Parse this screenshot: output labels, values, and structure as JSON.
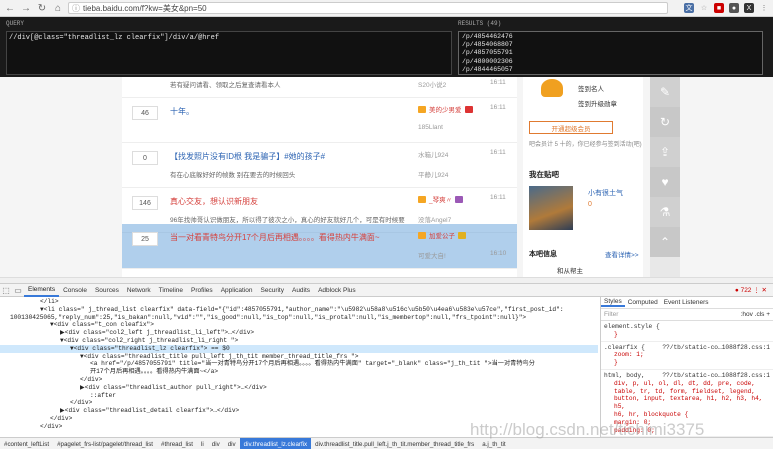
{
  "browser": {
    "url": "tieba.baidu.com/f?kw=美女&pn=50",
    "back_icon": "arrow-left-icon",
    "forward_icon": "arrow-right-icon",
    "reload_icon": "reload-icon",
    "home_icon": "home-icon"
  },
  "xpath_helper": {
    "query_label": "QUERY",
    "query": "//div[@class=\"threadlist_lz clearfix\"]/div/a/@href",
    "results_label": "RESULTS (49)",
    "results": [
      "/p/4854462476",
      "/p/4854068807",
      "/p/4857055791",
      "/p/4800002306",
      "/p/4844465057"
    ]
  },
  "threads": [
    {
      "count": "",
      "title": "",
      "abstract": "若有疑问请看、领取之后复查请看本人",
      "author": "",
      "last": "S20小说2",
      "time": "16:11"
    },
    {
      "count": "46",
      "title": "十年。",
      "abstract": "",
      "author": "美的少男爱",
      "last": "185Llant",
      "time": "16:11"
    },
    {
      "count": "0",
      "title": "【找发照片没有ID根 我是骗子】#她的孩子#",
      "abstract": "有在心底躲好好的帧数 别在要去的时候回头",
      "author": "水箱儿924",
      "last": "平静儿924",
      "time": "16:11"
    },
    {
      "count": "146",
      "title": "真心交友，想认识新朋友",
      "abstract": "96年找帅哥认识做朋友，所以得了彼次之小，真心的好友就好几个，可是有时候要",
      "author": "_琴爽〃",
      "last": "没落Angel7",
      "time": "16:11"
    },
    {
      "count": "25",
      "title": "当一对看青特鸟分开17个月后再相遇。。。。看得热内牛满面~",
      "abstract": "",
      "author": "加爱公子",
      "last": "可爱大自!",
      "time": "16:10"
    }
  ],
  "sidebar": {
    "sign_label": "签到名人",
    "more_label": "签到升级勋章",
    "join_label": "开通超级会员",
    "stats_text": "吧会员计 5 十的，你已经参与签到活动(吧)",
    "my_tieba": "我在贴吧",
    "username": "小有很土气",
    "level": "0",
    "bottom_label": "本吧信息",
    "bottom_link": "查看详情>>",
    "bottom_user": "和从帮主"
  },
  "devtools": {
    "tabs": [
      "Elements",
      "Console",
      "Sources",
      "Network",
      "Timeline",
      "Profiles",
      "Application",
      "Security",
      "Audits",
      "Adblock Plus"
    ],
    "warning": "722",
    "lines": [
      {
        "indent": 40,
        "text": "</li>"
      },
      {
        "indent": 40,
        "text": "▼<li class=\" j_thread_list clearfix\" data-field=\"{\"id\":4857055791,\"author_name\":\"\\u5982\\u58a8\\u516c\\u5b50\\u4ea6\\u583e\\u57ce\",\"first_post_id\":"
      },
      {
        "indent": 10,
        "text": "100130425065,\"reply_num\":25,\"is_bakan\":null,\"vid\":\"\",\"is_good\":null,\"is_top\":null,\"is_protal\":null,\"is_membertop\":null,\"frs_tpoint\":null}\">"
      },
      {
        "indent": 50,
        "text": "▼<div class=\"t_con cleafix\">"
      },
      {
        "indent": 60,
        "text": "▶<div class=\"col2_left j_threadlist_li_left\">…</div>"
      },
      {
        "indent": 60,
        "text": "▼<div class=\"col2_right j_threadlist_li_right \">"
      },
      {
        "indent": 70,
        "text": "▼<div class=\"threadlist_lz clearfix\"> == $0"
      },
      {
        "indent": 80,
        "text": "▼<div class=\"threadlist_title pull_left j_th_tit  member_thread_title_frs \">"
      },
      {
        "indent": 90,
        "text": "<a href=\"/p/4857055791\" title=\"当一对青特鸟分开17个月后再相遇。。。。看得热内牛满面\" target=\"_blank\" class=\"j_th_tit \">当一对青特鸟分"
      },
      {
        "indent": 90,
        "text": "开17个月后再相遇。。。。看得热内牛满面~</a>"
      },
      {
        "indent": 80,
        "text": "</div>"
      },
      {
        "indent": 80,
        "text": "▶<div class=\"threadlist_author pull_right\">…</div>"
      },
      {
        "indent": 90,
        "text": "::after"
      },
      {
        "indent": 70,
        "text": "</div>"
      },
      {
        "indent": 60,
        "text": "▶<div class=\"threadlist_detail clearfix\">…</div>"
      },
      {
        "indent": 50,
        "text": "</div>"
      },
      {
        "indent": 40,
        "text": "</div>"
      }
    ],
    "styles_tabs": [
      "Styles",
      "Computed",
      "Event Listeners"
    ],
    "filter_placeholder": "Filter",
    "filter_hov": ":hov  .cls  +",
    "style_blocks": [
      {
        "selector": "element.style {",
        "link": "",
        "props": [
          "}"
        ]
      },
      {
        "selector": ".clearfix {",
        "link": "??/tb/static-co…1088f28.css:1",
        "props": [
          "zoom: 1;",
          "}"
        ]
      },
      {
        "selector": "html, body,",
        "link": "??/tb/static-co…1088f28.css:1",
        "props": [
          "div, p, ul, ol, dl, dt, dd, pre, code,",
          "table, tr, td, form, fieldset, legend,",
          "button, input, textarea, h1, h2, h3, h4, h5,",
          "h6, hr, blockquote {",
          "margin: 0;",
          "padding: 0;"
        ]
      }
    ],
    "breadcrumbs": [
      "#content_leftList",
      "#pagelet_frs-list/pagelet/thread_list",
      "#thread_list",
      "li",
      "div",
      "div",
      "div.threadlist_lz.clearfix",
      "div.threadlist_title.pull_left.j_th_tit.member_thread_title_frs",
      "a.j_th_tit"
    ],
    "active_crumb": 6
  },
  "watermark": "http://blog.csdn.net/tichimi3375"
}
